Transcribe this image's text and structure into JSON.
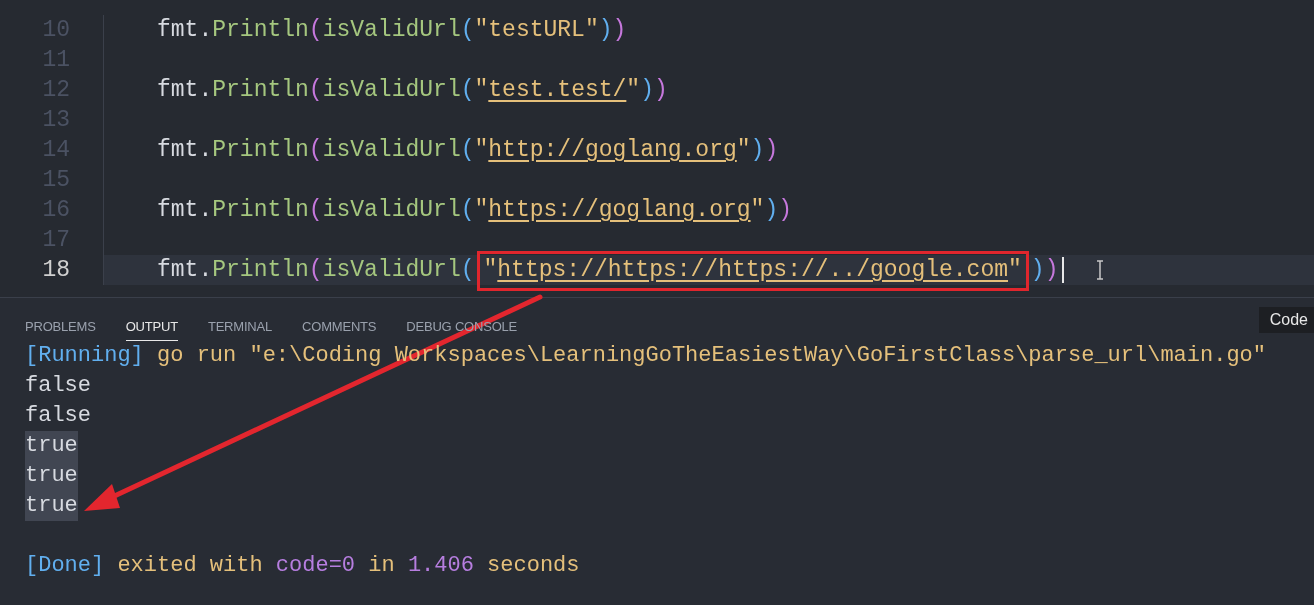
{
  "editor": {
    "lines": [
      {
        "number": "10",
        "current": false,
        "tokens": [
          {
            "kind": "plain",
            "text": "fmt."
          },
          {
            "kind": "func",
            "text": "Println"
          },
          {
            "kind": "paren-outer",
            "text": "("
          },
          {
            "kind": "func",
            "text": "isValidUrl"
          },
          {
            "kind": "paren-inner",
            "text": "("
          },
          {
            "kind": "string",
            "text": "\"testURL\""
          },
          {
            "kind": "paren-inner",
            "text": ")"
          },
          {
            "kind": "paren-outer",
            "text": ")"
          }
        ]
      },
      {
        "number": "11",
        "current": false
      },
      {
        "number": "12",
        "current": false,
        "tokens": [
          {
            "kind": "plain",
            "text": "fmt."
          },
          {
            "kind": "func",
            "text": "Println"
          },
          {
            "kind": "paren-outer",
            "text": "("
          },
          {
            "kind": "func",
            "text": "isValidUrl"
          },
          {
            "kind": "paren-inner",
            "text": "("
          },
          {
            "kind": "string",
            "text": "\""
          },
          {
            "kind": "link",
            "text": "test.test/"
          },
          {
            "kind": "string",
            "text": "\""
          },
          {
            "kind": "paren-inner",
            "text": ")"
          },
          {
            "kind": "paren-outer",
            "text": ")"
          }
        ]
      },
      {
        "number": "13",
        "current": false
      },
      {
        "number": "14",
        "current": false,
        "tokens": [
          {
            "kind": "plain",
            "text": "fmt."
          },
          {
            "kind": "func",
            "text": "Println"
          },
          {
            "kind": "paren-outer",
            "text": "("
          },
          {
            "kind": "func",
            "text": "isValidUrl"
          },
          {
            "kind": "paren-inner",
            "text": "("
          },
          {
            "kind": "string",
            "text": "\""
          },
          {
            "kind": "link",
            "text": "http://goglang.org"
          },
          {
            "kind": "string",
            "text": "\""
          },
          {
            "kind": "paren-inner",
            "text": ")"
          },
          {
            "kind": "paren-outer",
            "text": ")"
          }
        ]
      },
      {
        "number": "15",
        "current": false
      },
      {
        "number": "16",
        "current": false,
        "tokens": [
          {
            "kind": "plain",
            "text": "fmt."
          },
          {
            "kind": "func",
            "text": "Println"
          },
          {
            "kind": "paren-outer",
            "text": "("
          },
          {
            "kind": "func",
            "text": "isValidUrl"
          },
          {
            "kind": "paren-inner",
            "text": "("
          },
          {
            "kind": "string",
            "text": "\""
          },
          {
            "kind": "link",
            "text": "https://goglang.org"
          },
          {
            "kind": "string",
            "text": "\""
          },
          {
            "kind": "paren-inner",
            "text": ")"
          },
          {
            "kind": "paren-outer",
            "text": ")"
          }
        ]
      },
      {
        "number": "17",
        "current": false
      },
      {
        "number": "18",
        "current": true,
        "tokens": [
          {
            "kind": "plain",
            "text": "fmt."
          },
          {
            "kind": "func",
            "text": "Println"
          },
          {
            "kind": "paren-outer",
            "text": "("
          },
          {
            "kind": "func",
            "text": "isValidUrl"
          },
          {
            "kind": "paren-inner",
            "text": "("
          },
          {
            "kind": "boxed-string",
            "quote": "\"",
            "text": "https://https://https://../google.com"
          },
          {
            "kind": "paren-inner",
            "text": ")"
          },
          {
            "kind": "paren-outer",
            "text": ")"
          }
        ]
      }
    ]
  },
  "panel": {
    "tabs": [
      {
        "label": "PROBLEMS",
        "selected": false
      },
      {
        "label": "OUTPUT",
        "selected": true
      },
      {
        "label": "TERMINAL",
        "selected": false
      },
      {
        "label": "COMMENTS",
        "selected": false
      },
      {
        "label": "DEBUG CONSOLE",
        "selected": false
      }
    ],
    "tooltip": "Code",
    "output": [
      {
        "highlighted": false,
        "segments": [
          {
            "kind": "tag",
            "text": "[Running]"
          },
          {
            "kind": "cmd",
            "text": " go run \"e:\\Coding Workspaces\\LearningGoTheEasiestWay\\GoFirstClass\\parse_url\\main.go\""
          }
        ]
      },
      {
        "highlighted": false,
        "segments": [
          {
            "kind": "plain",
            "text": "false"
          }
        ]
      },
      {
        "highlighted": false,
        "segments": [
          {
            "kind": "plain",
            "text": "false"
          }
        ]
      },
      {
        "highlighted": true,
        "segments": [
          {
            "kind": "plain",
            "text": "true"
          }
        ]
      },
      {
        "highlighted": true,
        "segments": [
          {
            "kind": "plain",
            "text": "true"
          }
        ]
      },
      {
        "highlighted": true,
        "segments": [
          {
            "kind": "plain",
            "text": "true"
          }
        ]
      },
      {
        "highlighted": false
      },
      {
        "highlighted": false,
        "segments": [
          {
            "kind": "tag",
            "text": "[Done]"
          },
          {
            "kind": "cmd",
            "text": " exited with "
          },
          {
            "kind": "num",
            "text": "code=0"
          },
          {
            "kind": "cmd",
            "text": " in "
          },
          {
            "kind": "num",
            "text": "1.406"
          },
          {
            "kind": "cmd",
            "text": " seconds"
          }
        ]
      }
    ]
  }
}
